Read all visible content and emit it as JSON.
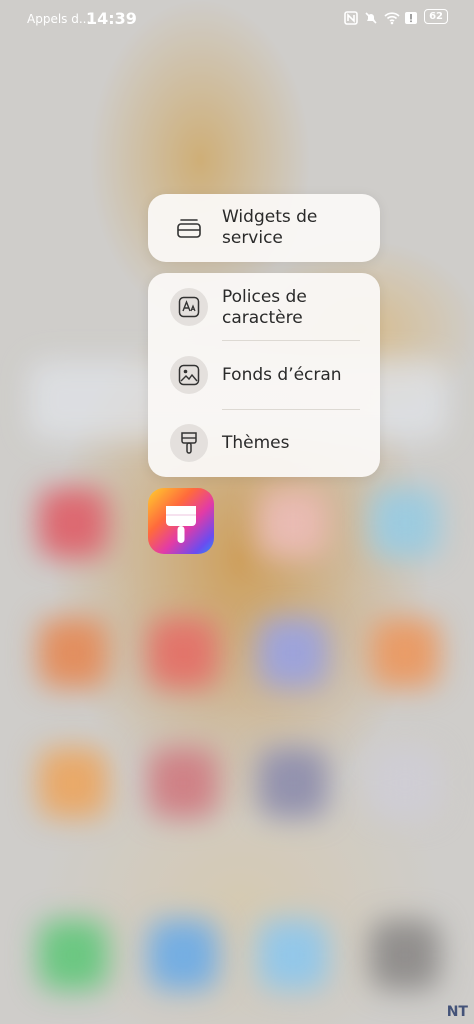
{
  "status_bar": {
    "carrier": "Appels d...",
    "time": "14:39",
    "battery": "62"
  },
  "service_card": {
    "item": {
      "label": "Widgets de service",
      "icon": "widget-icon"
    }
  },
  "menu_card": {
    "items": [
      {
        "label": "Polices de caractère",
        "icon": "font-icon"
      },
      {
        "label": "Fonds d’écran",
        "icon": "wallpaper-icon"
      },
      {
        "label": "Thèmes",
        "icon": "theme-brush-icon"
      }
    ]
  },
  "app_icon": {
    "name": "themes-app-icon"
  },
  "watermark": {
    "text": "NT"
  }
}
